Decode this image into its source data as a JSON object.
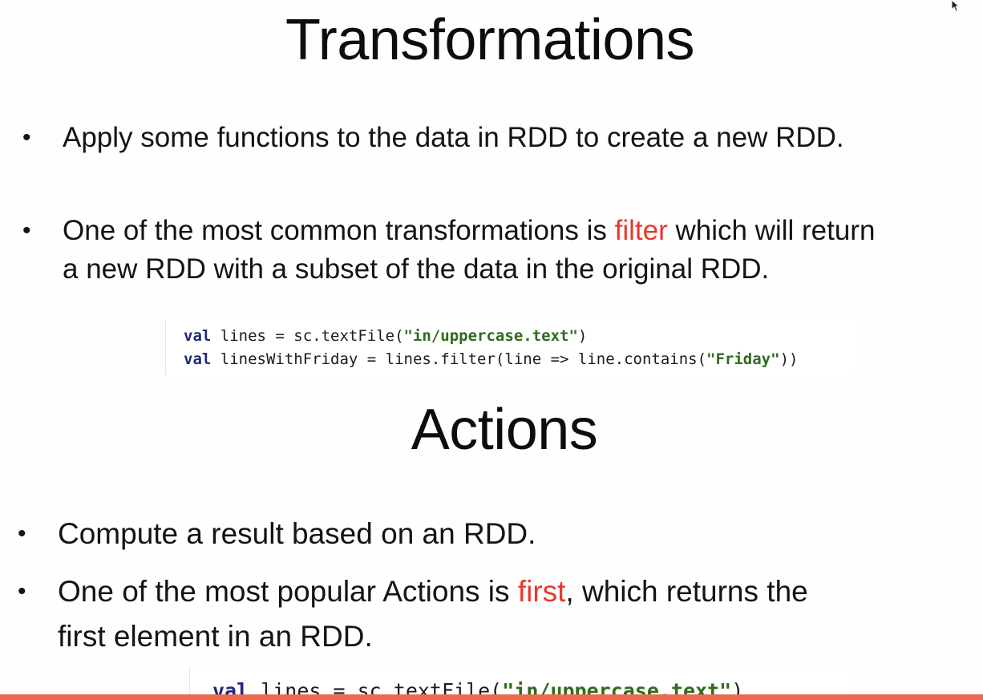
{
  "slide": {
    "title_transformations": "Transformations",
    "title_actions": "Actions",
    "accent_color": "#e8382c",
    "bottom_bar_color": "#ec6a4e"
  },
  "transformations": {
    "bullet_1": "Apply some functions to the data in RDD to create a new RDD.",
    "bullet_2_before": "One of the most common transformations is ",
    "bullet_2_highlight": "filter",
    "bullet_2_after": " which will return",
    "bullet_2_line2": "a new RDD with a subset of the data in the original RDD.",
    "code": {
      "line1_kw": "val",
      "line1_mid": " lines = sc.textFile(",
      "line1_str": "\"in/uppercase.text\"",
      "line1_end": ")",
      "line2_kw": "val",
      "line2_mid": " linesWithFriday = lines.filter(line => line.contains(",
      "line2_str": "\"Friday\"",
      "line2_end": "))"
    }
  },
  "actions": {
    "bullet_1": "Compute a result based on an RDD.",
    "bullet_2_before": "One of the most popular Actions is ",
    "bullet_2_highlight": "first",
    "bullet_2_after": ", which returns the",
    "bullet_2_line2": "first element in an RDD.",
    "code": {
      "line1_kw": "val",
      "line1_mid": " lines = sc.textFile(",
      "line1_str": "\"in/uppercase.text\"",
      "line1_end": ")"
    }
  },
  "icons": {
    "cursor": "mouse-pointer-icon",
    "bullet": "bullet-dot-icon"
  },
  "bullet_glyph": "•"
}
